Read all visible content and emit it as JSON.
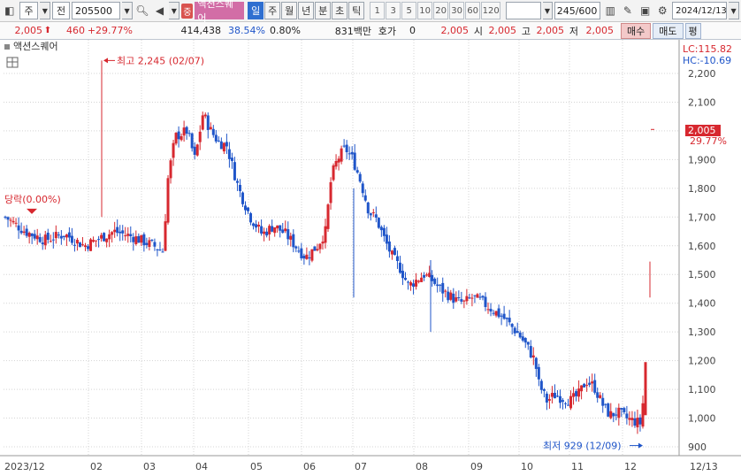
{
  "toolbar": {
    "market_label": "주",
    "adj_label": "전",
    "code": "205500",
    "badge": "중",
    "stock_name": "액션스퀘어",
    "periods": [
      "일",
      "주",
      "월",
      "년",
      "분",
      "초",
      "틱"
    ],
    "active_period": "일",
    "intervals": [
      "1",
      "3",
      "5",
      "10",
      "20",
      "30",
      "60",
      "120"
    ],
    "count": "245/600",
    "date": "2024/12/13"
  },
  "info": {
    "price": "2,005",
    "change": "460",
    "change_pct": "+29.77%",
    "volume": "414,438",
    "vol_pct": "38.54%",
    "turnover_pct": "0.80%",
    "amount": "831백만",
    "hoga_label": "호가",
    "hoga_value": "0",
    "hoga_price": "2,005",
    "open_label": "시",
    "open": "2,005",
    "high_label": "고",
    "high": "2,005",
    "low_label": "저",
    "low": "2,005",
    "buy_label": "매수",
    "sell_label": "매도",
    "eval_label": "평"
  },
  "chart": {
    "legend": "액션스퀘어",
    "lc": "LC:115.82",
    "hc": "HC:-10.69",
    "high_annot": "최고 2,245 (02/07)",
    "low_annot": "최저 929 (12/09)",
    "decline_annot": "당락(0.00%)",
    "current_price": "2,005",
    "current_pct": "29.77%",
    "colors": {
      "up": "#d7282f",
      "down": "#1f55c9",
      "grid": "#d4d4d4"
    }
  },
  "chart_data": {
    "type": "candlestick",
    "title": "액션스퀘어",
    "x_labels": [
      "2023/12",
      "02",
      "03",
      "04",
      "05",
      "06",
      "07",
      "08",
      "09",
      "10",
      "11",
      "12",
      "12/13"
    ],
    "y_ticks": [
      900,
      1000,
      1100,
      1200,
      1300,
      1400,
      1500,
      1600,
      1700,
      1800,
      1900,
      2000,
      2100,
      2200
    ],
    "ylim": [
      900,
      2260
    ],
    "close_path": [
      [
        0,
        1700
      ],
      [
        10,
        1650
      ],
      [
        20,
        1620
      ],
      [
        30,
        1640
      ],
      [
        40,
        1600
      ],
      [
        55,
        1650
      ],
      [
        65,
        1630
      ],
      [
        75,
        1600
      ],
      [
        80,
        1580
      ],
      [
        82,
        1820
      ],
      [
        86,
        1980
      ],
      [
        92,
        2000
      ],
      [
        96,
        1900
      ],
      [
        100,
        2060
      ],
      [
        104,
        2000
      ],
      [
        108,
        1960
      ],
      [
        112,
        1950
      ],
      [
        118,
        1800
      ],
      [
        124,
        1700
      ],
      [
        130,
        1640
      ],
      [
        136,
        1670
      ],
      [
        142,
        1640
      ],
      [
        148,
        1590
      ],
      [
        152,
        1560
      ],
      [
        158,
        1600
      ],
      [
        162,
        1650
      ],
      [
        165,
        1840
      ],
      [
        168,
        1900
      ],
      [
        172,
        1940
      ],
      [
        176,
        1900
      ],
      [
        180,
        1820
      ],
      [
        184,
        1720
      ],
      [
        188,
        1690
      ],
      [
        192,
        1620
      ],
      [
        196,
        1560
      ],
      [
        200,
        1520
      ],
      [
        204,
        1460
      ],
      [
        208,
        1480
      ],
      [
        212,
        1500
      ],
      [
        216,
        1480
      ],
      [
        220,
        1450
      ],
      [
        224,
        1430
      ],
      [
        228,
        1410
      ],
      [
        232,
        1400
      ],
      [
        236,
        1420
      ],
      [
        240,
        1410
      ],
      [
        244,
        1390
      ],
      [
        248,
        1370
      ],
      [
        252,
        1350
      ],
      [
        256,
        1320
      ],
      [
        260,
        1290
      ],
      [
        264,
        1250
      ],
      [
        268,
        1200
      ],
      [
        270,
        1120
      ],
      [
        274,
        1060
      ],
      [
        278,
        1080
      ],
      [
        282,
        1070
      ],
      [
        286,
        1060
      ],
      [
        290,
        1080
      ],
      [
        294,
        1130
      ],
      [
        298,
        1110
      ],
      [
        302,
        1050
      ],
      [
        306,
        1010
      ],
      [
        310,
        1020
      ],
      [
        314,
        1000
      ],
      [
        318,
        990
      ],
      [
        322,
        980
      ],
      [
        324,
        1200
      ]
    ],
    "high": {
      "value": 2245,
      "date": "02/07"
    },
    "low": {
      "value": 929,
      "date": "12/09"
    },
    "last": 2005
  }
}
